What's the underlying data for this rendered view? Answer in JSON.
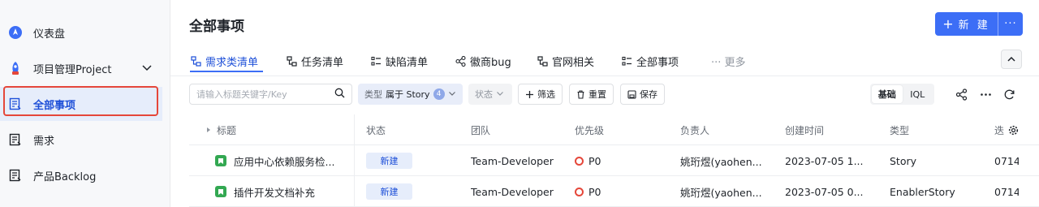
{
  "sidebar": {
    "items": [
      {
        "label": "仪表盘",
        "icon": "dashboard-icon"
      },
      {
        "label": "项目管理Project",
        "icon": "rocket-icon"
      },
      {
        "label": "全部事项",
        "icon": "list-doc-icon"
      },
      {
        "label": "需求",
        "icon": "list-doc-icon"
      },
      {
        "label": "产品Backlog",
        "icon": "list-doc-icon"
      }
    ]
  },
  "header": {
    "title": "全部事项",
    "new_button": "新 建",
    "more_button": "···"
  },
  "tabs": [
    {
      "label": "需求类清单",
      "icon": "hierarchy-icon"
    },
    {
      "label": "任务清单",
      "icon": "hierarchy-icon"
    },
    {
      "label": "缺陷清单",
      "icon": "list-icon"
    },
    {
      "label": "徽商bug",
      "icon": "share-icon"
    },
    {
      "label": "官网相关",
      "icon": "hierarchy-icon"
    },
    {
      "label": "全部事项",
      "icon": "list-icon"
    },
    {
      "label": "··· 更多",
      "icon": ""
    }
  ],
  "toolbar": {
    "search_placeholder": "请输入标题关键字/Key",
    "type_filter_key": "类型",
    "type_filter_value": "属于 Story",
    "type_filter_count": "4",
    "status_filter": "状态",
    "filter_button": "筛选",
    "reset_button": "重置",
    "save_button": "保存",
    "mode_basic": "基础",
    "mode_iql": "IQL"
  },
  "table": {
    "columns": [
      "标题",
      "状态",
      "团队",
      "优先级",
      "负责人",
      "创建时间",
      "类型",
      "迭"
    ],
    "rows": [
      {
        "title": "应用中心依赖服务检...",
        "status": "新建",
        "team": "Team-Developer",
        "priority": "P0",
        "owner": "姚珩煜(yaohen...",
        "created": "2023-07-05 1...",
        "type": "Story",
        "iteration": "0714"
      },
      {
        "title": "插件开发文档补充",
        "status": "新建",
        "team": "Team-Developer",
        "priority": "P0",
        "owner": "姚珩煜(yaohen...",
        "created": "2023-07-05 0...",
        "type": "EnablerStory",
        "iteration": "0714"
      }
    ]
  },
  "colors": {
    "accent": "#3c6ef6",
    "highlight_border": "#e5473a",
    "priority_p0": "#e5473a",
    "story_icon": "#33a852"
  }
}
